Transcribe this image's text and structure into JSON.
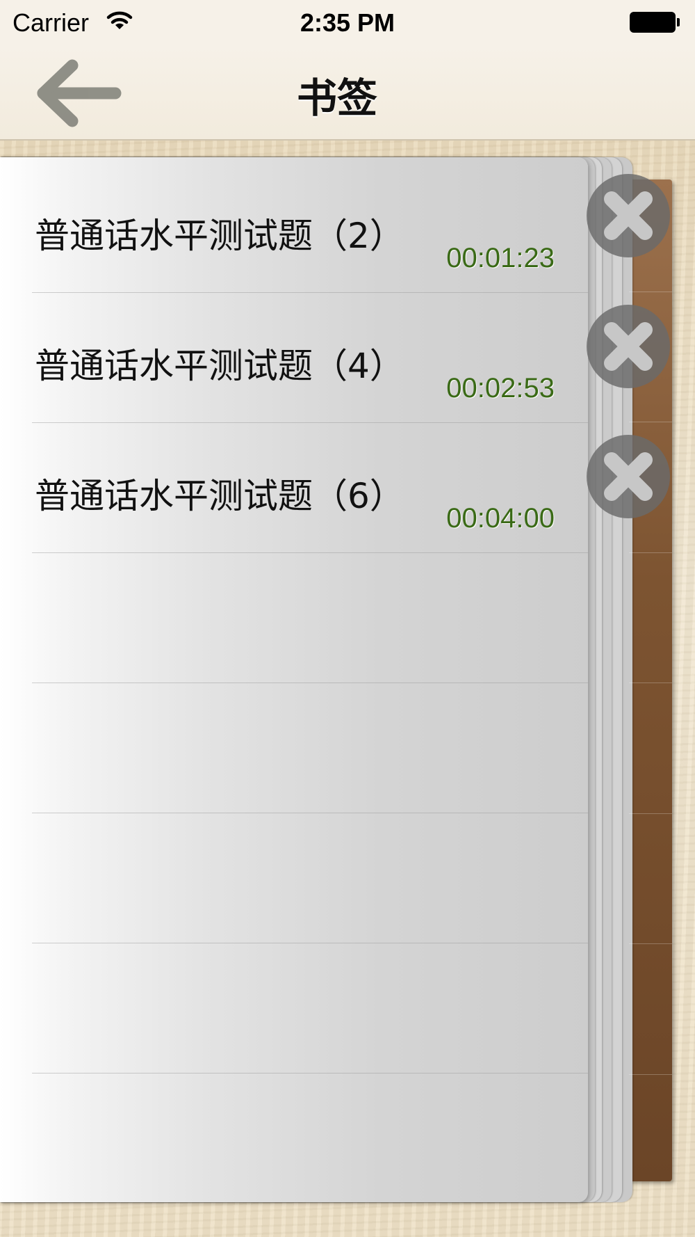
{
  "status_bar": {
    "carrier": "Carrier",
    "time": "2:35 PM",
    "wifi_icon": "wifi-icon",
    "battery_icon": "battery-icon"
  },
  "nav_bar": {
    "title": "书签",
    "back_icon": "arrow-left-icon"
  },
  "bookmarks": [
    {
      "title": "普通话水平测试题（2）",
      "time": "00:01:23",
      "delete_icon": "close-icon"
    },
    {
      "title": "普通话水平测试题（4）",
      "time": "00:02:53",
      "delete_icon": "close-icon"
    },
    {
      "title": "普通话水平测试题（6）",
      "time": "00:04:00",
      "delete_icon": "close-icon"
    }
  ],
  "colors": {
    "time_text": "#3a6a16",
    "wood": "#eddfc3",
    "spine": "#7d5431"
  }
}
